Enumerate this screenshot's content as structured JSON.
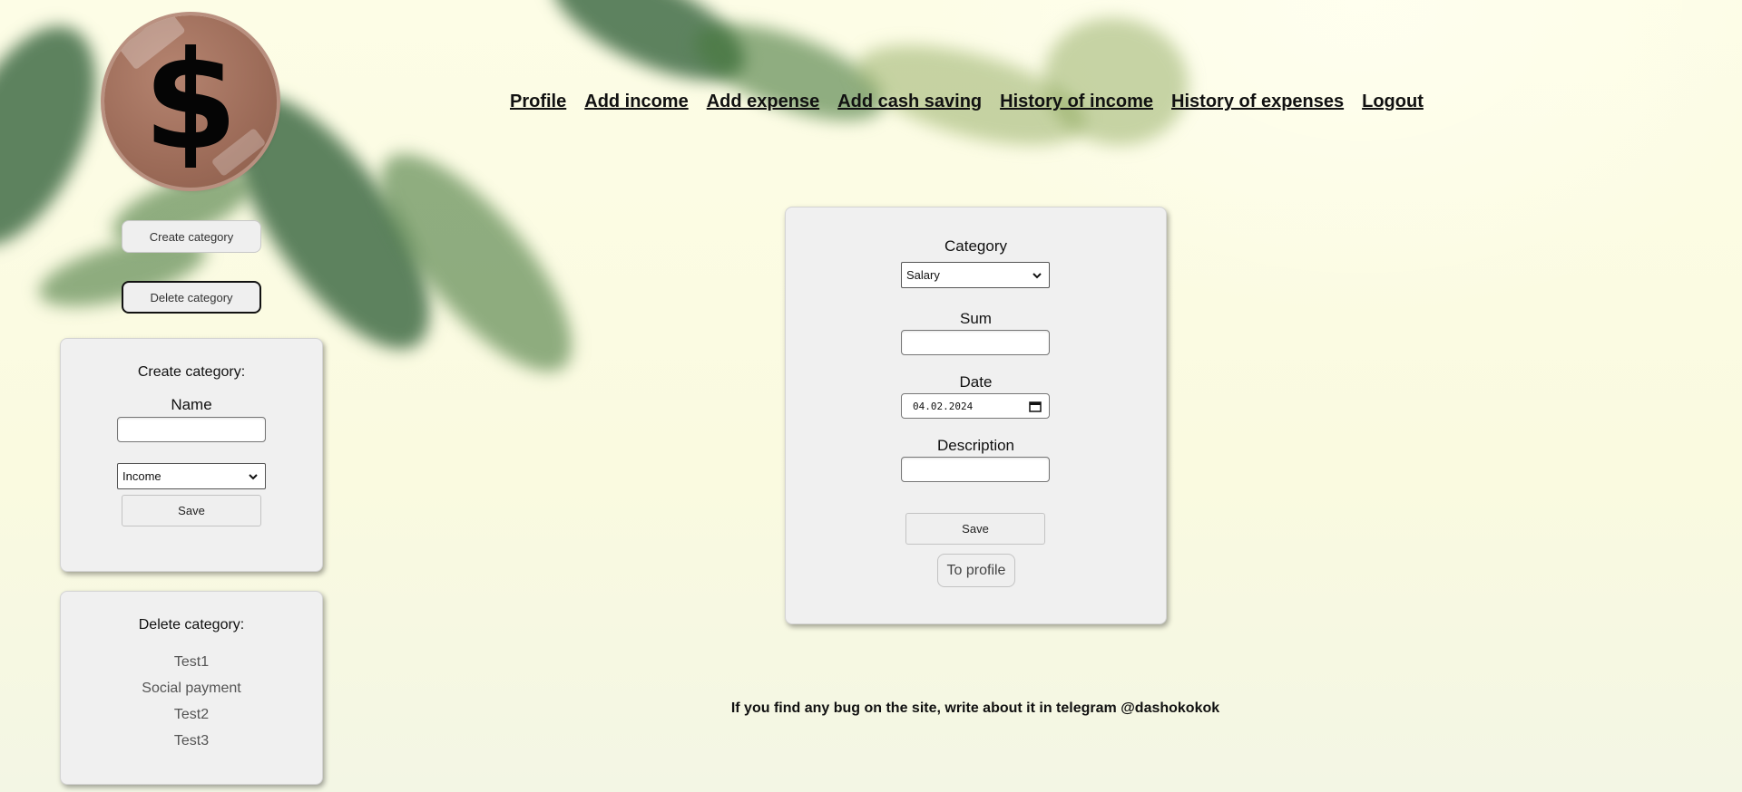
{
  "logo": {
    "glyph": "$",
    "icon": "dollar-sign-icon"
  },
  "nav": {
    "items": [
      {
        "label": "Profile"
      },
      {
        "label": "Add income"
      },
      {
        "label": "Add expense"
      },
      {
        "label": "Add cash saving"
      },
      {
        "label": "History of income"
      },
      {
        "label": "History of expenses"
      },
      {
        "label": "Logout"
      }
    ]
  },
  "sidebar": {
    "create_button": "Create category",
    "delete_button": "Delete category",
    "create_panel": {
      "title": "Create category:",
      "name_label": "Name",
      "name_value": "",
      "type_select": "Income",
      "save_label": "Save"
    },
    "delete_panel": {
      "title": "Delete category:",
      "categories": [
        "Test1",
        "Social payment",
        "Test2",
        "Test3"
      ]
    }
  },
  "form": {
    "category_label": "Category",
    "category_value": "Salary",
    "sum_label": "Sum",
    "sum_value": "",
    "date_label": "Date",
    "date_value": "04.02.2024",
    "description_label": "Description",
    "description_value": "",
    "save_label": "Save",
    "to_profile_label": "To profile"
  },
  "footer": {
    "note": "If you find any bug on the site, write about it in telegram @dashokokok"
  },
  "colors": {
    "background": "#fbfbe4",
    "panel": "#f0f0f0",
    "logo_coin": "#9c6b58",
    "leaf": "#2d5a32"
  }
}
